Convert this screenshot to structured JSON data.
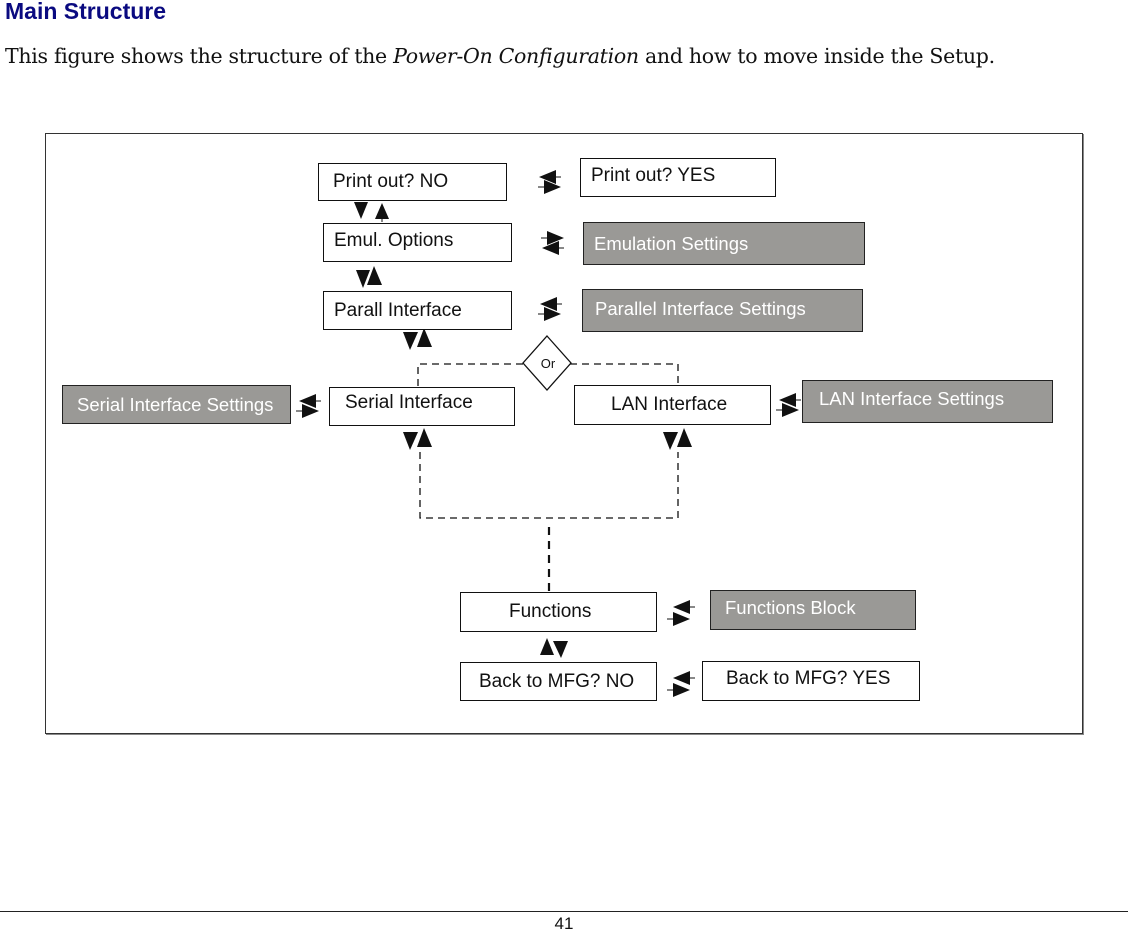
{
  "heading": "Main Structure",
  "intro": {
    "before": "This figure shows the structure of the ",
    "emphasis": "Power-On Configuration",
    "after": " and how to move inside the Setup."
  },
  "diagram": {
    "nodes": {
      "print_no": "Print out? NO",
      "print_yes": "Print out? YES",
      "emul_options": "Emul. Options",
      "emulation_settings": "Emulation Settings",
      "parall_interface": "Parall Interface",
      "parallel_settings": "Parallel Interface Settings",
      "or_label": "Or",
      "serial_settings": "Serial Interface Settings",
      "serial_interface": "Serial Interface",
      "lan_interface": "LAN Interface",
      "lan_settings": "LAN Interface Settings",
      "functions": "Functions",
      "functions_block": "Functions Block",
      "back_no": "Back to MFG? NO",
      "back_yes": "Back to MFG? YES"
    },
    "colors": {
      "heading": "#0a0a80",
      "shaded_box": "#9a9996",
      "line": "#111111"
    }
  },
  "footer": {
    "page_number": "41"
  }
}
